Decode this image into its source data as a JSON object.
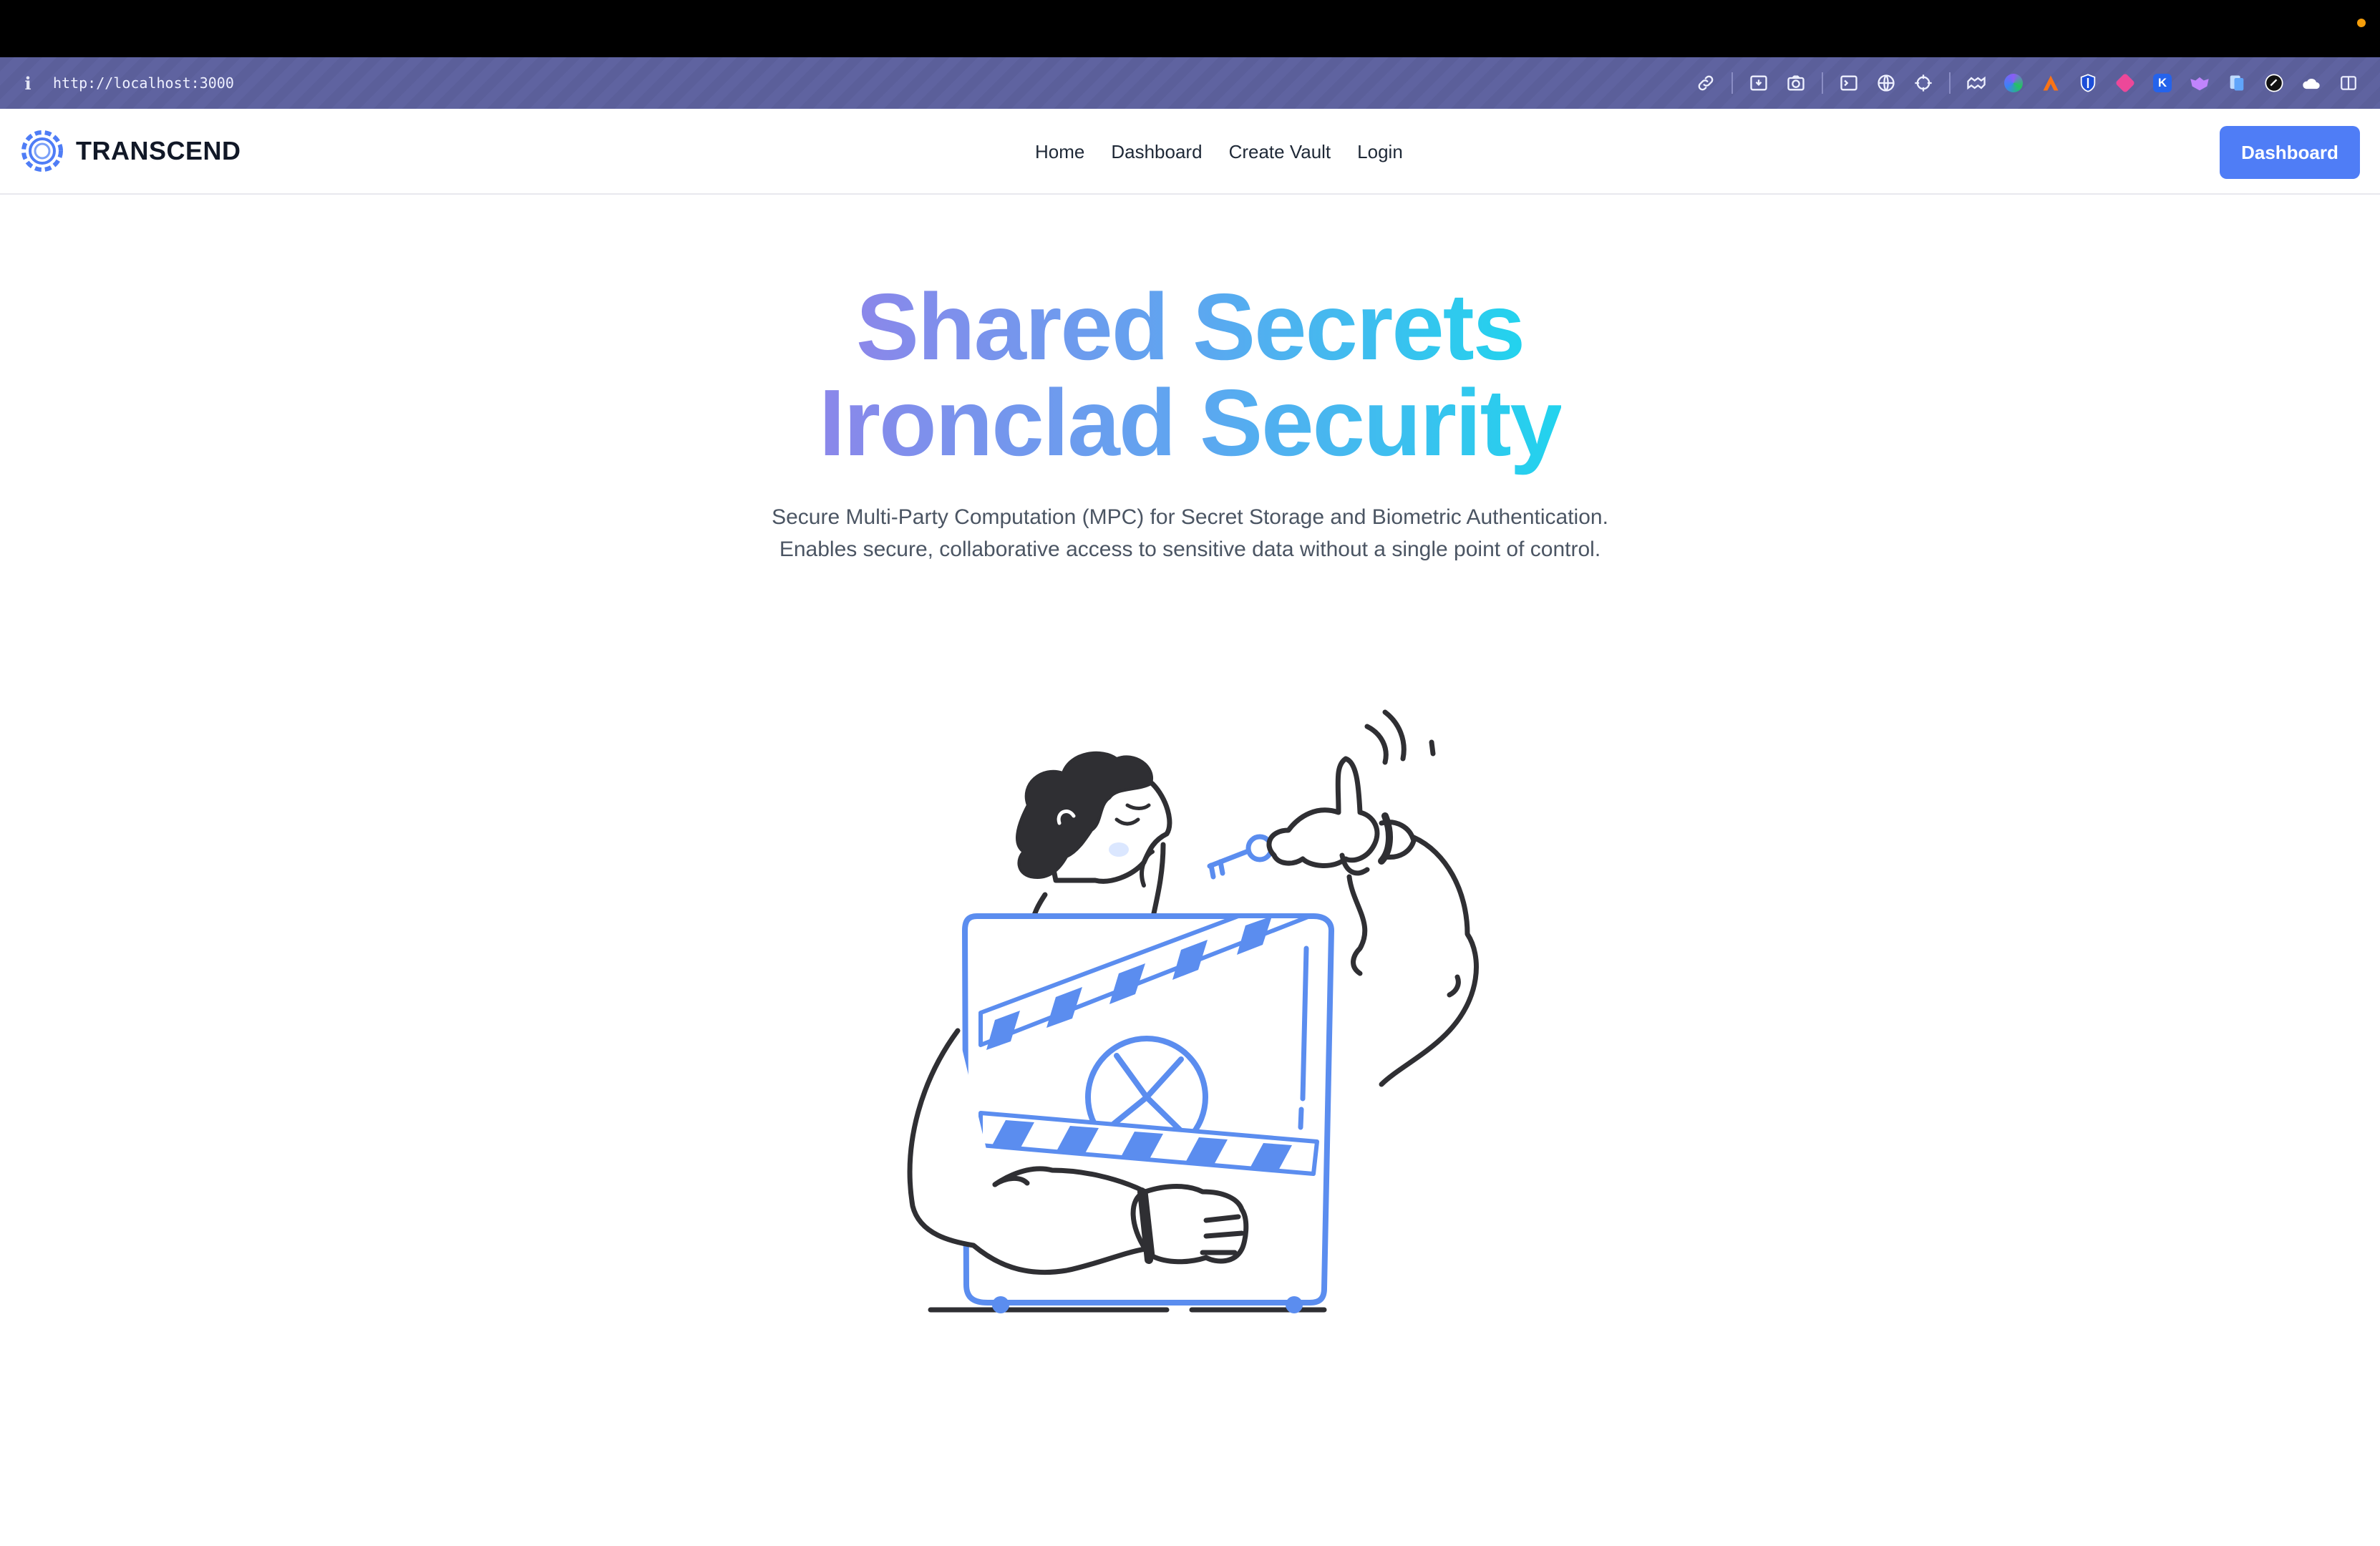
{
  "browser": {
    "url": "http://localhost:3000",
    "info_icon": "info-icon",
    "toolbar_icons": [
      "link-icon",
      "save-page-icon",
      "camera-icon",
      "terminal-icon",
      "globe-icon",
      "crosshair-icon",
      "extensions-icon",
      "color-palette-icon",
      "arrow-app-icon",
      "shield-icon",
      "puzzle-icon",
      "k-app-icon",
      "mask-icon",
      "copy-icon",
      "dark-circle-icon",
      "cloud-icon",
      "sidebar-toggle-icon"
    ],
    "toolbar_letter": "K"
  },
  "nav": {
    "brand": "TRANSCEND",
    "links": [
      "Home",
      "Dashboard",
      "Create Vault",
      "Login"
    ],
    "cta": "Dashboard"
  },
  "hero": {
    "line1": "Shared Secrets",
    "line2": "Ironclad Security",
    "subtitle": "Secure Multi-Party Computation (MPC) for Secret Storage and Biometric Authentication. Enables secure, collaborative access to sensitive data without a single point of control."
  },
  "colors": {
    "accent": "#4f7df6",
    "gradient_start": "#8b87ea",
    "gradient_end": "#22d3ee",
    "illustration_blue": "#5b8def",
    "ink": "#2f2f33"
  }
}
